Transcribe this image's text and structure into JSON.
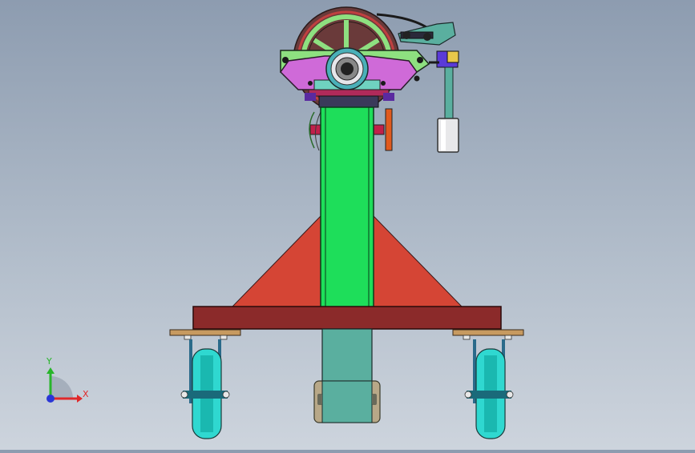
{
  "viewport": {
    "background_top": "#8d9cb0",
    "background_bottom": "#cdd4dd"
  },
  "triad": {
    "x_label": "X",
    "y_label": "Y",
    "x_color": "#e0282a",
    "y_color": "#27b52a",
    "z_color": "#2a36d6"
  },
  "model": {
    "colors": {
      "column": "#1ede5a",
      "gusset": "#d54535",
      "base_beam": "#8b2a2a",
      "lower_column": "#5aaf9f",
      "bracket": "#cf6ad8",
      "plate": "#8ee080",
      "wheel": "#2fd8d0",
      "caster_plate": "#c79a60",
      "weight": "#e8e8ea",
      "handle": "#e05a1e"
    }
  }
}
